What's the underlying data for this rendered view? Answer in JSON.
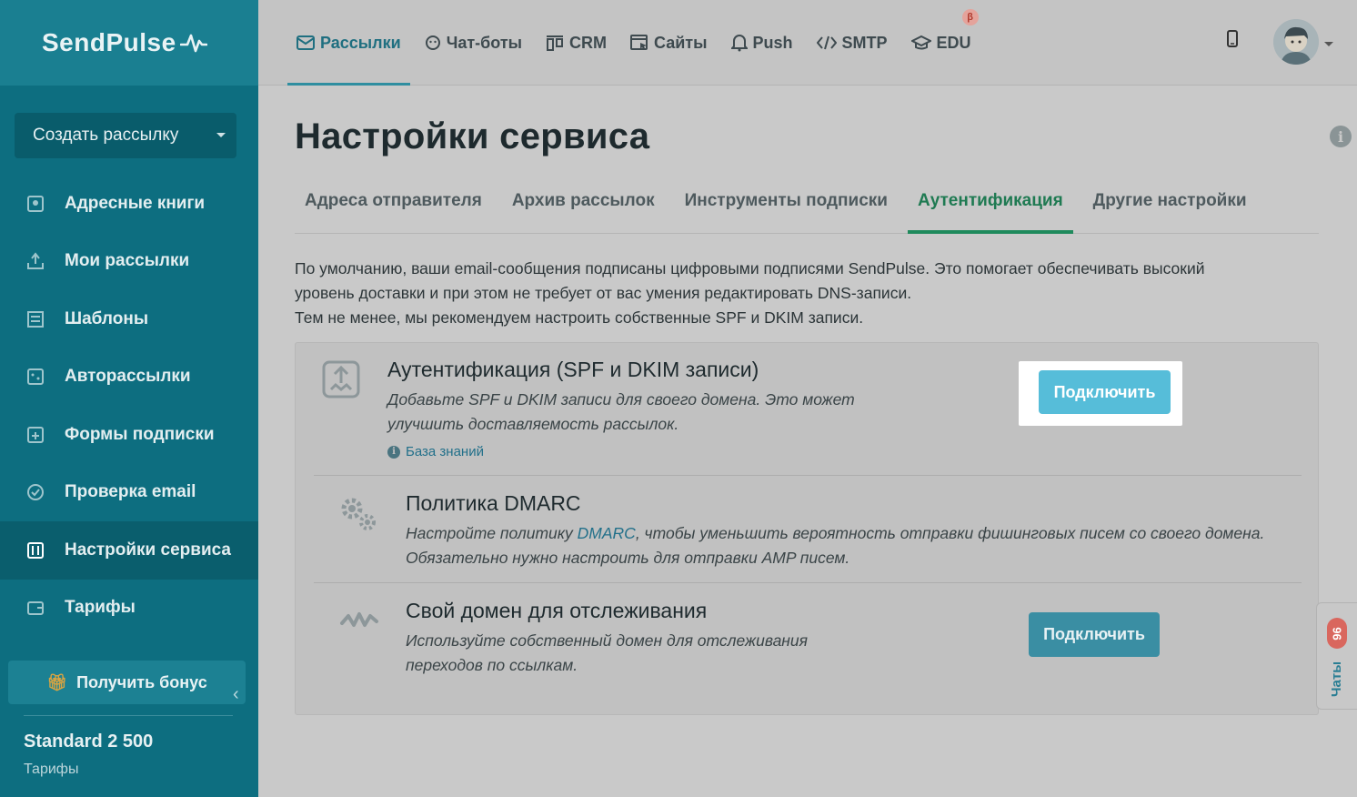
{
  "brand": {
    "logo_text": "SendPulse"
  },
  "sidebar": {
    "create_button": "Создать рассылку",
    "items": [
      {
        "label": "Адресные книги",
        "icon": "address-book-icon"
      },
      {
        "label": "Мои рассылки",
        "icon": "campaigns-icon"
      },
      {
        "label": "Шаблоны",
        "icon": "templates-icon"
      },
      {
        "label": "Авторассылки",
        "icon": "automation-icon"
      },
      {
        "label": "Формы подписки",
        "icon": "forms-icon"
      },
      {
        "label": "Проверка email",
        "icon": "verify-icon"
      },
      {
        "label": "Настройки сервиса",
        "icon": "settings-sliders-icon",
        "active": true
      },
      {
        "label": "Тарифы",
        "icon": "wallet-icon"
      }
    ],
    "bonus_button": "Получить бонус",
    "plan_name": "Standard 2 500",
    "plan_link": "Тарифы"
  },
  "topnav": {
    "items": [
      {
        "label": "Рассылки",
        "icon": "mail-icon",
        "active": true
      },
      {
        "label": "Чат-боты",
        "icon": "chatbot-icon"
      },
      {
        "label": "CRM",
        "icon": "crm-icon"
      },
      {
        "label": "Сайты",
        "icon": "sites-icon"
      },
      {
        "label": "Push",
        "icon": "bell-icon"
      },
      {
        "label": "SMTP",
        "icon": "code-icon"
      },
      {
        "label": "EDU",
        "icon": "graduation-cap-icon",
        "badge": "β"
      }
    ]
  },
  "page": {
    "title": "Настройки сервиса",
    "tabs": [
      {
        "label": "Адреса отправителя"
      },
      {
        "label": "Архив рассылок"
      },
      {
        "label": "Инструменты подписки"
      },
      {
        "label": "Аутентификация",
        "active": true
      },
      {
        "label": "Другие настройки"
      }
    ],
    "intro_line1": "По умолчанию, ваши email-сообщения подписаны цифровыми подписями SendPulse. Это помогает обеспечивать высокий",
    "intro_line2": "уровень доставки и при этом не требует от вас умения редактировать DNS-записи.",
    "intro_line3": "Тем не менее, мы рекомендуем настроить собственные SPF и DKIM записи."
  },
  "sections": {
    "auth": {
      "title": "Аутентификация (SPF и DKIM записи)",
      "desc_line1": "Добавьте SPF и DKIM записи для своего домена. Это может",
      "desc_line2": "улучшить доставляемость рассылок.",
      "kb_link": "База знаний",
      "button": "Подключить"
    },
    "dmarc": {
      "title": "Политика DMARC",
      "desc_pre": "Настройте политику ",
      "desc_link": "DMARC",
      "desc_post": ", чтобы уменьшить вероятность отправки фишинговых писем со своего домена.",
      "desc_line2": "Обязательно нужно настроить для отправки AMP писем."
    },
    "tracking": {
      "title": "Свой домен для отслеживания",
      "desc_line1": "Используйте собственный домен для отслеживания",
      "desc_line2": "переходов по ссылкам.",
      "button": "Подключить"
    }
  },
  "chat_widget": {
    "label": "Чаты",
    "count": "96"
  },
  "colors": {
    "sidebar": "#0d6e80",
    "accent_green": "#1f8a5c",
    "button_blue": "#56bdd9"
  }
}
